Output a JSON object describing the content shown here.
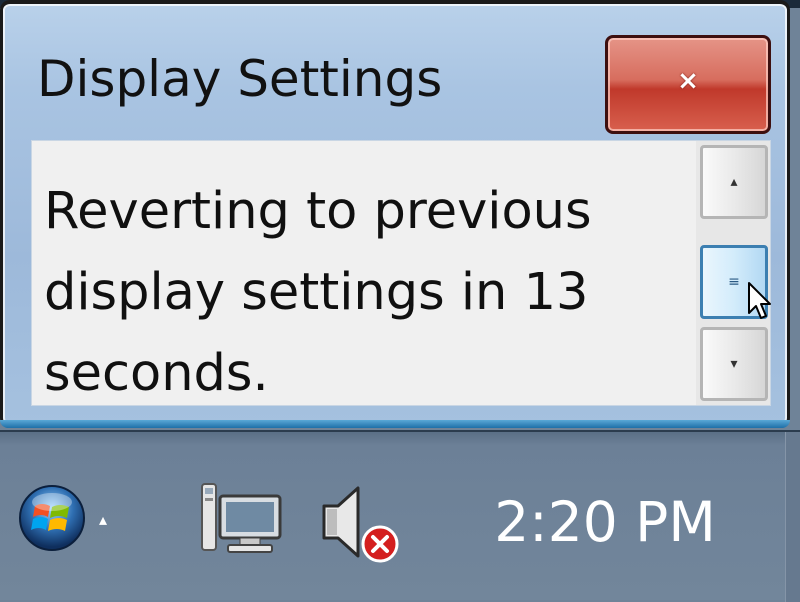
{
  "dialog": {
    "title": "Display Settings",
    "close_label": "×",
    "message": "Reverting to previous display settings in 13 seconds.",
    "scrollbar": {
      "up_glyph": "▴",
      "thumb_glyph": "≡",
      "down_glyph": "▾"
    }
  },
  "taskbar": {
    "start_icon": "windows-start-orb-icon",
    "tray_chevron": "▴",
    "network_icon": "network-monitor-icon",
    "volume_icon": "speaker-muted-icon",
    "clock_time": "2:20 PM"
  },
  "colors": {
    "close_button": "#c0392b",
    "taskbar": "#6f8398",
    "dialog_frame": "#a9c4e2"
  }
}
